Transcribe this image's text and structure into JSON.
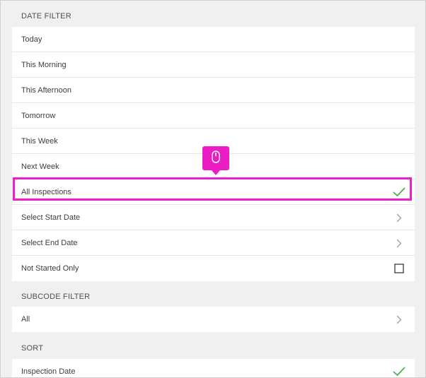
{
  "date_filter": {
    "header": "DATE FILTER",
    "items": [
      {
        "label": "Today"
      },
      {
        "label": "This Morning"
      },
      {
        "label": "This Afternoon"
      },
      {
        "label": "Tomorrow"
      },
      {
        "label": "This Week"
      },
      {
        "label": "Next Week"
      },
      {
        "label": "All Inspections",
        "selected": true,
        "icon": "checkmark-icon"
      },
      {
        "label": "Select Start Date",
        "icon": "chevron-right-icon"
      },
      {
        "label": "Select End Date",
        "icon": "chevron-right-icon"
      },
      {
        "label": "Not Started Only",
        "icon": "checkbox-icon",
        "checked": false
      }
    ]
  },
  "subcode_filter": {
    "header": "SUBCODE FILTER",
    "items": [
      {
        "label": "All",
        "icon": "chevron-right-icon"
      }
    ]
  },
  "sort": {
    "header": "SORT",
    "items": [
      {
        "label": "Inspection Date",
        "selected": true,
        "icon": "checkmark-icon"
      }
    ]
  },
  "colors": {
    "section_bg": "#f0f0f0",
    "highlight": "#ef1ec6",
    "checkmark": "#4caf50",
    "chevron": "#a0a0a0"
  },
  "overlay": {
    "icon": "mouse-icon"
  }
}
